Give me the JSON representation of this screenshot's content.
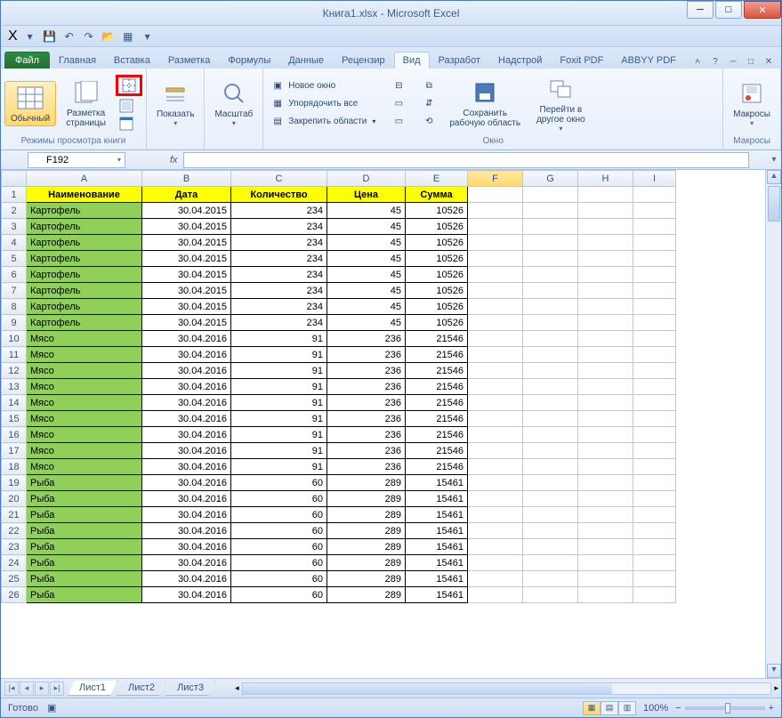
{
  "title": "Книга1.xlsx - Microsoft Excel",
  "qat": {
    "excel_badge": "X"
  },
  "tabs": {
    "file": "Файл",
    "list": [
      "Главная",
      "Вставка",
      "Разметка",
      "Формулы",
      "Данные",
      "Рецензир",
      "Вид",
      "Разработ",
      "Надстрой",
      "Foxit PDF",
      "ABBYY PDF"
    ],
    "active_index": 6
  },
  "ribbon": {
    "views": {
      "normal": "Обычный",
      "page_layout": "Разметка\nстраницы",
      "label": "Режимы просмотра книги"
    },
    "show": {
      "btn": "Показать"
    },
    "zoom": {
      "btn": "Масштаб"
    },
    "window": {
      "new_window": "Новое окно",
      "arrange": "Упорядочить все",
      "freeze": "Закрепить области",
      "save_workspace": "Сохранить\nрабочую область",
      "switch": "Перейти в\nдругое окно",
      "label": "Окно"
    },
    "macros": {
      "btn": "Макросы",
      "label": "Макросы"
    }
  },
  "namebox": "F192",
  "fx": "fx",
  "columns": [
    "A",
    "B",
    "C",
    "D",
    "E",
    "F",
    "G",
    "H",
    "I"
  ],
  "headers": [
    "Наименование",
    "Дата",
    "Количество",
    "Цена",
    "Сумма"
  ],
  "rows": [
    {
      "n": 2,
      "name": "Картофель",
      "date": "30.04.2015",
      "qty": "234",
      "price": "45",
      "sum": "10526"
    },
    {
      "n": 3,
      "name": "Картофель",
      "date": "30.04.2015",
      "qty": "234",
      "price": "45",
      "sum": "10526"
    },
    {
      "n": 4,
      "name": "Картофель",
      "date": "30.04.2015",
      "qty": "234",
      "price": "45",
      "sum": "10526"
    },
    {
      "n": 5,
      "name": "Картофель",
      "date": "30.04.2015",
      "qty": "234",
      "price": "45",
      "sum": "10526"
    },
    {
      "n": 6,
      "name": "Картофель",
      "date": "30.04.2015",
      "qty": "234",
      "price": "45",
      "sum": "10526"
    },
    {
      "n": 7,
      "name": "Картофель",
      "date": "30.04.2015",
      "qty": "234",
      "price": "45",
      "sum": "10526"
    },
    {
      "n": 8,
      "name": "Картофель",
      "date": "30.04.2015",
      "qty": "234",
      "price": "45",
      "sum": "10526"
    },
    {
      "n": 9,
      "name": "Картофель",
      "date": "30.04.2015",
      "qty": "234",
      "price": "45",
      "sum": "10526"
    },
    {
      "n": 10,
      "name": "Мясо",
      "date": "30.04.2016",
      "qty": "91",
      "price": "236",
      "sum": "21546"
    },
    {
      "n": 11,
      "name": "Мясо",
      "date": "30.04.2016",
      "qty": "91",
      "price": "236",
      "sum": "21546"
    },
    {
      "n": 12,
      "name": "Мясо",
      "date": "30.04.2016",
      "qty": "91",
      "price": "236",
      "sum": "21546"
    },
    {
      "n": 13,
      "name": "Мясо",
      "date": "30.04.2016",
      "qty": "91",
      "price": "236",
      "sum": "21546"
    },
    {
      "n": 14,
      "name": "Мясо",
      "date": "30.04.2016",
      "qty": "91",
      "price": "236",
      "sum": "21546"
    },
    {
      "n": 15,
      "name": "Мясо",
      "date": "30.04.2016",
      "qty": "91",
      "price": "236",
      "sum": "21546"
    },
    {
      "n": 16,
      "name": "Мясо",
      "date": "30.04.2016",
      "qty": "91",
      "price": "236",
      "sum": "21546"
    },
    {
      "n": 17,
      "name": "Мясо",
      "date": "30.04.2016",
      "qty": "91",
      "price": "236",
      "sum": "21546"
    },
    {
      "n": 18,
      "name": "Мясо",
      "date": "30.04.2016",
      "qty": "91",
      "price": "236",
      "sum": "21546"
    },
    {
      "n": 19,
      "name": "Рыба",
      "date": "30.04.2016",
      "qty": "60",
      "price": "289",
      "sum": "15461"
    },
    {
      "n": 20,
      "name": "Рыба",
      "date": "30.04.2016",
      "qty": "60",
      "price": "289",
      "sum": "15461"
    },
    {
      "n": 21,
      "name": "Рыба",
      "date": "30.04.2016",
      "qty": "60",
      "price": "289",
      "sum": "15461"
    },
    {
      "n": 22,
      "name": "Рыба",
      "date": "30.04.2016",
      "qty": "60",
      "price": "289",
      "sum": "15461"
    },
    {
      "n": 23,
      "name": "Рыба",
      "date": "30.04.2016",
      "qty": "60",
      "price": "289",
      "sum": "15461"
    },
    {
      "n": 24,
      "name": "Рыба",
      "date": "30.04.2016",
      "qty": "60",
      "price": "289",
      "sum": "15461"
    },
    {
      "n": 25,
      "name": "Рыба",
      "date": "30.04.2016",
      "qty": "60",
      "price": "289",
      "sum": "15461"
    },
    {
      "n": 26,
      "name": "Рыба",
      "date": "30.04.2016",
      "qty": "60",
      "price": "289",
      "sum": "15461"
    }
  ],
  "sheets": [
    "Лист1",
    "Лист2",
    "Лист3"
  ],
  "active_sheet": 0,
  "status": {
    "ready": "Готово",
    "zoom": "100%"
  }
}
